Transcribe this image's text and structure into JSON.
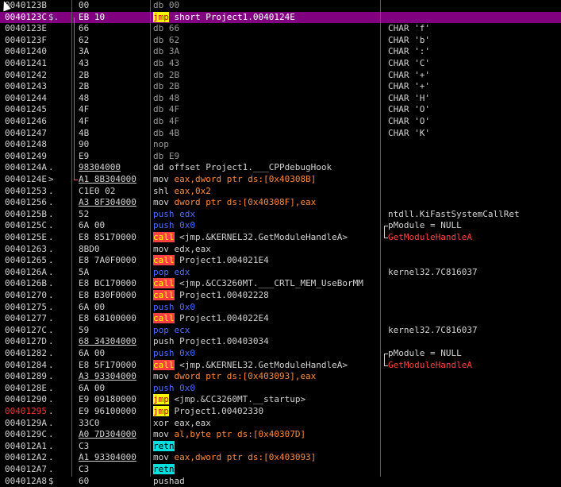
{
  "rows": [
    {
      "addr": "0040123B",
      "mark": "",
      "hex": "00",
      "op": "",
      "args": "db 00",
      "argtype": "dim",
      "cmt": ""
    },
    {
      "addr": "0040123C",
      "mark": "$.",
      "hex": "EB 10",
      "op": "jmp",
      "args": " short Project1.0040124E",
      "argtype": "",
      "cmt": "",
      "sel": true
    },
    {
      "addr": "0040123E",
      "mark": "",
      "hex": "66",
      "op": "",
      "args": "db 66",
      "argtype": "dim",
      "cmt": "CHAR 'f'"
    },
    {
      "addr": "0040123F",
      "mark": "",
      "hex": "62",
      "op": "",
      "args": "db 62",
      "argtype": "dim",
      "cmt": "CHAR 'b'"
    },
    {
      "addr": "00401240",
      "mark": "",
      "hex": "3A",
      "op": "",
      "args": "db 3A",
      "argtype": "dim",
      "cmt": "CHAR ':'"
    },
    {
      "addr": "00401241",
      "mark": "",
      "hex": "43",
      "op": "",
      "args": "db 43",
      "argtype": "dim",
      "cmt": "CHAR 'C'"
    },
    {
      "addr": "00401242",
      "mark": "",
      "hex": "2B",
      "op": "",
      "args": "db 2B",
      "argtype": "dim",
      "cmt": "CHAR '+'"
    },
    {
      "addr": "00401243",
      "mark": "",
      "hex": "2B",
      "op": "",
      "args": "db 2B",
      "argtype": "dim",
      "cmt": "CHAR '+'"
    },
    {
      "addr": "00401244",
      "mark": "",
      "hex": "48",
      "op": "",
      "args": "db 48",
      "argtype": "dim",
      "cmt": "CHAR 'H'"
    },
    {
      "addr": "00401245",
      "mark": "",
      "hex": "4F",
      "op": "",
      "args": "db 4F",
      "argtype": "dim",
      "cmt": "CHAR 'O'"
    },
    {
      "addr": "00401246",
      "mark": "",
      "hex": "4F",
      "op": "",
      "args": "db 4F",
      "argtype": "dim",
      "cmt": "CHAR 'O'"
    },
    {
      "addr": "00401247",
      "mark": "",
      "hex": "4B",
      "op": "",
      "args": "db 4B",
      "argtype": "dim",
      "cmt": "CHAR 'K'"
    },
    {
      "addr": "00401248",
      "mark": "",
      "hex": "90",
      "op": "",
      "args": "nop",
      "argtype": "dim",
      "cmt": ""
    },
    {
      "addr": "00401249",
      "mark": "",
      "hex": "E9",
      "op": "",
      "args": "db E9",
      "argtype": "dim",
      "cmt": ""
    },
    {
      "addr": "0040124A",
      "mark": ".",
      "hex": "98304000",
      "hexul": true,
      "op": "",
      "args": "dd offset Project1.___CPPdebugHook",
      "argtype": "",
      "cmt": ""
    },
    {
      "addr": "0040124E",
      "mark": ">",
      "hex": "A1 8B304000",
      "hexul": true,
      "op": "mov",
      "args": " eax,dword ptr ds:[0x40308B]",
      "argtype": "mem",
      "cmt": ""
    },
    {
      "addr": "00401253",
      "mark": ".",
      "hex": "C1E0 02",
      "op": "shl",
      "args": " eax,0x2",
      "argtype": "mem",
      "cmt": ""
    },
    {
      "addr": "00401256",
      "mark": ".",
      "hex": "A3 8F304000",
      "hexul": true,
      "op": "mov",
      "args": " dword ptr ds:[0x40308F],eax",
      "argtype": "mem",
      "cmt": ""
    },
    {
      "addr": "0040125B",
      "mark": ".",
      "hex": "52",
      "op": "push",
      "args": " edx",
      "argtype": "blue",
      "cmt": "ntdll.KiFastSystemCallRet"
    },
    {
      "addr": "0040125C",
      "mark": ".",
      "hex": "6A 00",
      "op": "push",
      "args": " 0x0",
      "argtype": "blue",
      "cmt": "pModule = NULL",
      "bracket": "top"
    },
    {
      "addr": "0040125E",
      "mark": ".",
      "hex": "E8 85170000",
      "op": "call",
      "args": " <jmp.&KERNEL32.GetModuleHandleA>",
      "argtype": "",
      "cmt": "GetModuleHandleA",
      "cmtred": true,
      "bracket": "bottom"
    },
    {
      "addr": "00401263",
      "mark": ".",
      "hex": "8BD0",
      "op": "mov",
      "args": " edx,eax",
      "argtype": "",
      "cmt": ""
    },
    {
      "addr": "00401265",
      "mark": ".",
      "hex": "E8 7A0F0000",
      "op": "call",
      "args": " Project1.004021E4",
      "argtype": "",
      "cmt": ""
    },
    {
      "addr": "0040126A",
      "mark": ".",
      "hex": "5A",
      "op": "pop",
      "args": " edx",
      "argtype": "blue",
      "cmt": "kernel32.7C816037"
    },
    {
      "addr": "0040126B",
      "mark": ".",
      "hex": "E8 BC170000",
      "op": "call",
      "args": " <jmp.&CC3260MT.___CRTL_MEM_UseBorMM",
      "argtype": "",
      "cmt": ""
    },
    {
      "addr": "00401270",
      "mark": ".",
      "hex": "E8 B30F0000",
      "op": "call",
      "args": " Project1.00402228",
      "argtype": "",
      "cmt": ""
    },
    {
      "addr": "00401275",
      "mark": ".",
      "hex": "6A 00",
      "op": "push",
      "args": " 0x0",
      "argtype": "blue",
      "cmt": ""
    },
    {
      "addr": "00401277",
      "mark": ".",
      "hex": "E8 68100000",
      "op": "call",
      "args": " Project1.004022E4",
      "argtype": "",
      "cmt": ""
    },
    {
      "addr": "0040127C",
      "mark": ".",
      "hex": "59",
      "op": "pop",
      "args": " ecx",
      "argtype": "blue",
      "cmt": "kernel32.7C816037"
    },
    {
      "addr": "0040127D",
      "mark": ".",
      "hex": "68 34304000",
      "hexul": true,
      "op": "push",
      "args": " Project1.00403034",
      "argtype": "",
      "cmt": ""
    },
    {
      "addr": "00401282",
      "mark": ".",
      "hex": "6A 00",
      "op": "push",
      "args": " 0x0",
      "argtype": "blue",
      "cmt": "pModule = NULL",
      "bracket": "top"
    },
    {
      "addr": "00401284",
      "mark": ".",
      "hex": "E8 5F170000",
      "op": "call",
      "args": " <jmp.&KERNEL32.GetModuleHandleA>",
      "argtype": "",
      "cmt": "GetModuleHandleA",
      "cmtred": true,
      "bracket": "bottom"
    },
    {
      "addr": "00401289",
      "mark": ".",
      "hex": "A3 93304000",
      "hexul": true,
      "op": "mov",
      "args": " dword ptr ds:[0x403093],eax",
      "argtype": "mem",
      "cmt": ""
    },
    {
      "addr": "0040128E",
      "mark": ".",
      "hex": "6A 00",
      "op": "push",
      "args": " 0x0",
      "argtype": "blue",
      "cmt": ""
    },
    {
      "addr": "00401290",
      "mark": ".",
      "hex": "E9 09180000",
      "op": "jmp",
      "args": " <jmp.&CC3260MT.__startup>",
      "argtype": "",
      "cmt": ""
    },
    {
      "addr": "00401295",
      "addrbp": true,
      "mark": ".",
      "hex": "E9 96100000",
      "op": "jmp",
      "args": " Project1.00402330",
      "argtype": "",
      "cmt": ""
    },
    {
      "addr": "0040129A",
      "mark": ".",
      "hex": "33C0",
      "op": "xor",
      "args": " eax,eax",
      "argtype": "",
      "cmt": ""
    },
    {
      "addr": "0040129C",
      "mark": ".",
      "hex": "A0 7D304000",
      "hexul": true,
      "op": "mov",
      "args": " al,byte ptr ds:[0x40307D]",
      "argtype": "mem",
      "cmt": ""
    },
    {
      "addr": "004012A1",
      "mark": ".",
      "hex": "C3",
      "op": "retn",
      "args": "",
      "argtype": "",
      "cmt": ""
    },
    {
      "addr": "004012A2",
      "mark": ".",
      "hex": "A1 93304000",
      "hexul": true,
      "op": "mov",
      "args": " eax,dword ptr ds:[0x403093]",
      "argtype": "mem",
      "cmt": ""
    },
    {
      "addr": "004012A7",
      "mark": ".",
      "hex": "C3",
      "op": "retn",
      "args": "",
      "argtype": "",
      "cmt": ""
    },
    {
      "addr": "004012A8",
      "mark": "$",
      "hex": "60",
      "op": "",
      "args": "pushad",
      "argtype": "",
      "cmt": ""
    }
  ]
}
